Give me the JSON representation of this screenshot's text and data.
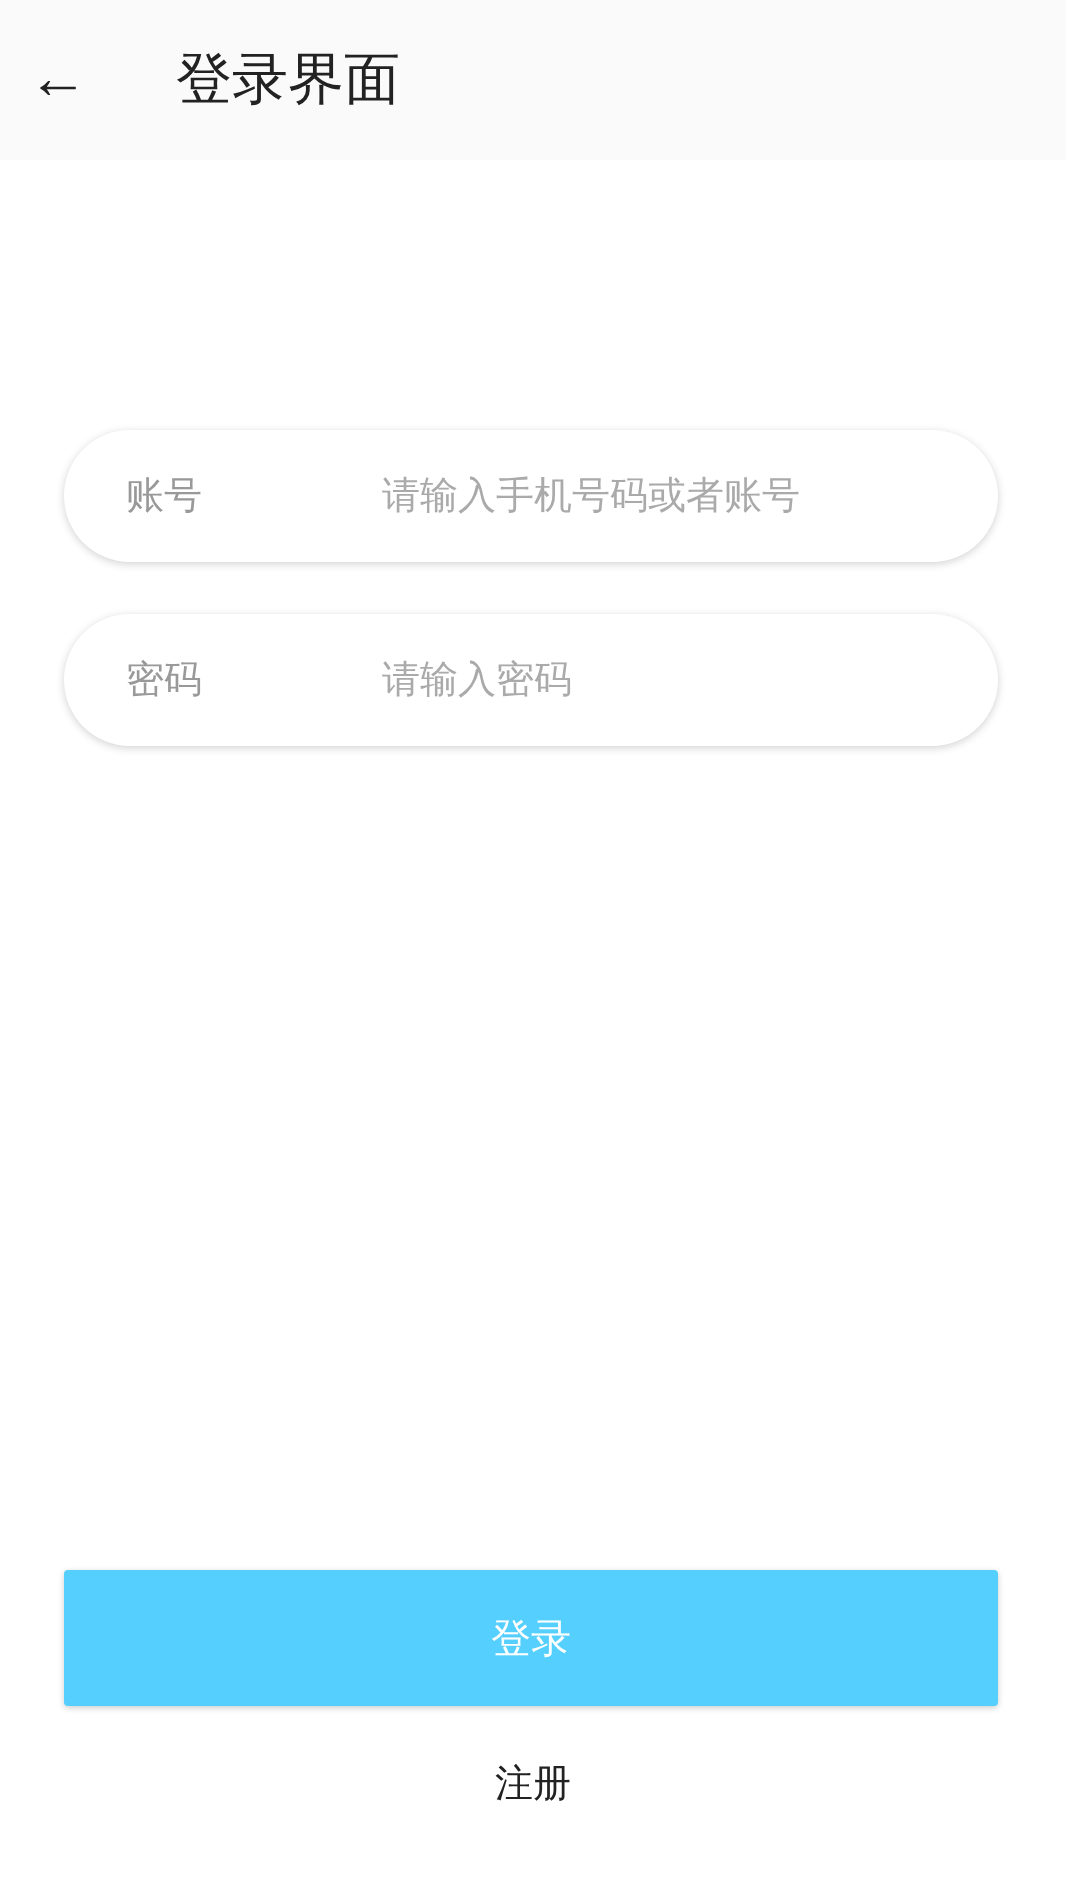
{
  "header": {
    "back": "←",
    "title": "登录界面"
  },
  "fields": [
    {
      "label": "账号",
      "placeholder": "请输入手机号码或者账号"
    },
    {
      "label": "密码",
      "placeholder": "请输入密码"
    }
  ],
  "login_button": "登录",
  "register_link": "注册"
}
